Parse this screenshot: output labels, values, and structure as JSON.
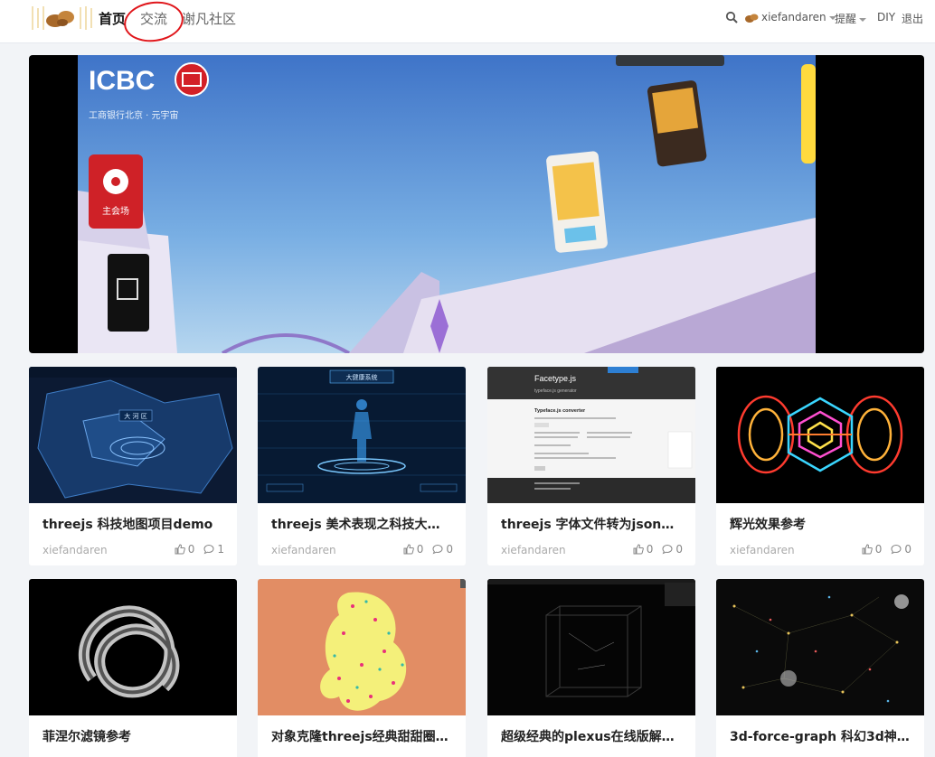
{
  "nav": {
    "items": [
      {
        "label": "首页",
        "active": true
      },
      {
        "label": "交流",
        "active": false
      },
      {
        "label": "谢凡社区",
        "active": false
      }
    ],
    "right": {
      "username": "xiefandaren",
      "remind": "提醒",
      "diy": "DIY",
      "logout": "退出"
    }
  },
  "banner": {
    "brand": "ICBC",
    "subtitle": "工商银行北京 · 元宇宙",
    "button": "主会场",
    "slides": 5,
    "active_slide": 2
  },
  "cards": [
    {
      "title": "threejs 科技地图项目demo",
      "author": "xiefandaren",
      "likes": "0",
      "comments": "1"
    },
    {
      "title": "threejs 美术表现之科技大…",
      "author": "xiefandaren",
      "likes": "0",
      "comments": "0"
    },
    {
      "title": "threejs 字体文件转为json…",
      "author": "xiefandaren",
      "likes": "0",
      "comments": "0"
    },
    {
      "title": "辉光效果参考",
      "author": "xiefandaren",
      "likes": "0",
      "comments": "0"
    },
    {
      "title": "菲涅尔滤镜参考",
      "author": "",
      "likes": "",
      "comments": ""
    },
    {
      "title": "对象克隆threejs经典甜甜圈…",
      "author": "",
      "likes": "",
      "comments": ""
    },
    {
      "title": "超级经典的plexus在线版解…",
      "author": "",
      "likes": "",
      "comments": ""
    },
    {
      "title": "3d-force-graph 科幻3d神…",
      "author": "",
      "likes": "",
      "comments": ""
    }
  ],
  "thumb_labels": {
    "map": "大 河 区",
    "ui": "大健康系统",
    "facetype_title": "Facetype.js",
    "facetype_sub": "typeface.js generator",
    "facetype_heading": "Typeface.js converter"
  },
  "colors": {
    "accent_red": "#e0161b",
    "text_dark": "#222222",
    "muted": "#aaaaaa",
    "bg": "#f2f4f7"
  }
}
